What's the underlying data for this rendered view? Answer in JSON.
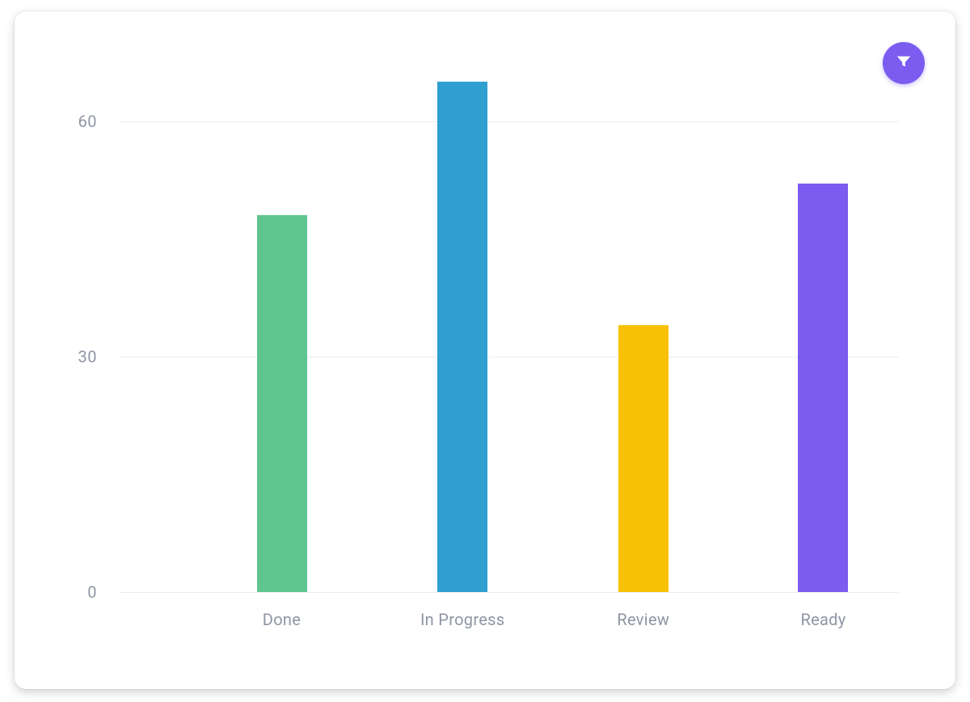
{
  "chart_data": {
    "type": "bar",
    "categories": [
      "Done",
      "In Progress",
      "Review",
      "Ready"
    ],
    "values": [
      48,
      65,
      34,
      52
    ],
    "colors": [
      "#5fc58e",
      "#2f9fd0",
      "#f7c206",
      "#7b5cf0"
    ],
    "yticks": [
      0,
      30,
      60
    ],
    "ylim": [
      0,
      68
    ],
    "grid": true
  },
  "filter_icon": "filter"
}
